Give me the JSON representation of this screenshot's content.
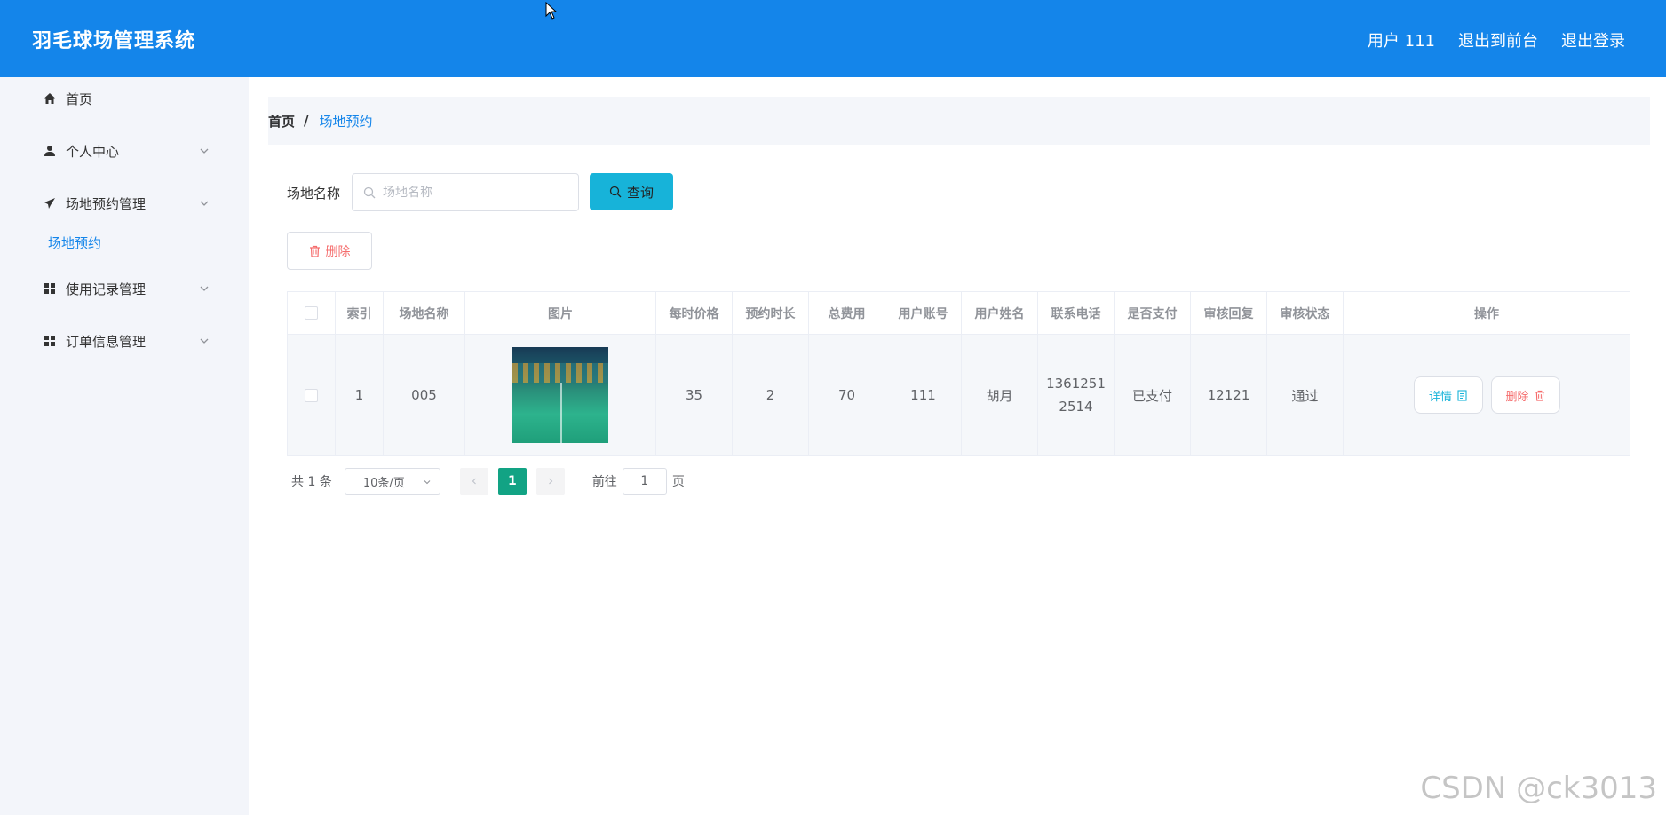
{
  "header": {
    "title": "羽毛球场管理系统",
    "user": "用户 111",
    "to_front": "退出到前台",
    "logout": "退出登录"
  },
  "sidebar": {
    "items": [
      {
        "label": "首页",
        "icon": "home-icon"
      },
      {
        "label": "个人中心",
        "icon": "user-icon"
      },
      {
        "label": "场地预约管理",
        "icon": "paper-plane-icon"
      },
      {
        "label": "使用记录管理",
        "icon": "grid-icon"
      },
      {
        "label": "订单信息管理",
        "icon": "grid-icon"
      }
    ],
    "sub_item": "场地预约"
  },
  "breadcrumb": {
    "home": "首页",
    "separator": "/",
    "current": "场地预约"
  },
  "search": {
    "label": "场地名称",
    "placeholder": "场地名称",
    "value": "",
    "button": "查询"
  },
  "toolbar": {
    "delete_label": "删除"
  },
  "table": {
    "columns": [
      "索引",
      "场地名称",
      "图片",
      "每时价格",
      "预约时长",
      "总费用",
      "用户账号",
      "用户姓名",
      "联系电话",
      "是否支付",
      "审核回复",
      "审核状态",
      "操作"
    ],
    "rows": [
      {
        "index": "1",
        "venue": "005",
        "price": "35",
        "duration": "2",
        "total": "70",
        "account": "111",
        "name": "胡月",
        "phone_line1": "1361251",
        "phone_line2": "2514",
        "paid": "已支付",
        "reply": "12121",
        "status": "通过",
        "detail_label": "详情",
        "delete_label": "删除"
      }
    ]
  },
  "pagination": {
    "total": "共 1 条",
    "page_size": "10条/页",
    "current_page": "1",
    "goto_label": "前往",
    "goto_value": "1",
    "page_suffix": "页"
  },
  "watermark": "CSDN @ck3013",
  "colors": {
    "header": "#1485ea",
    "query_button": "#17b3d9",
    "danger": "#f56c6c",
    "page_active": "#12a384"
  }
}
